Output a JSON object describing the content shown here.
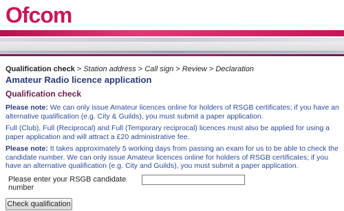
{
  "header": {
    "logo_text": "Ofcom"
  },
  "breadcrumb": {
    "current": "Qualification check",
    "separator": ">",
    "steps": [
      "Station address",
      "Call sign",
      "Review",
      "Declaration"
    ]
  },
  "page": {
    "title": "Amateur Radio licence application",
    "section_title": "Qualification check"
  },
  "notes": {
    "p1_lead": "Please note:",
    "p1_text": "We can only issue Amateur licences online for holders of RSGB certificates; if you have an alternative qualification (e.g. City & Guilds), you must submit a paper application.",
    "p2_text": "Full (Club), Full (Reciprocal) and Full (Temporary reciprocal) licences must also be applied for using a paper application and will attract a £20 administrative fee.",
    "p3_lead": "Please note:",
    "p3_text": "It takes approximately 5 working days from passing an exam for us to be able to check the candidate number. We can only issue Amateur licences online for holders of RSGB certificates; if you have an alternative qualification (e.g. City and Guilds), you must submit a paper application."
  },
  "form": {
    "candidate_label": "Please enter your RSGB candidate number",
    "candidate_value": "",
    "submit_label": "Check qualification"
  },
  "colors": {
    "brand": "#c8175c",
    "heading": "#2a3a7a",
    "section": "#6b1a4e",
    "body_text": "#2a4a9a"
  }
}
